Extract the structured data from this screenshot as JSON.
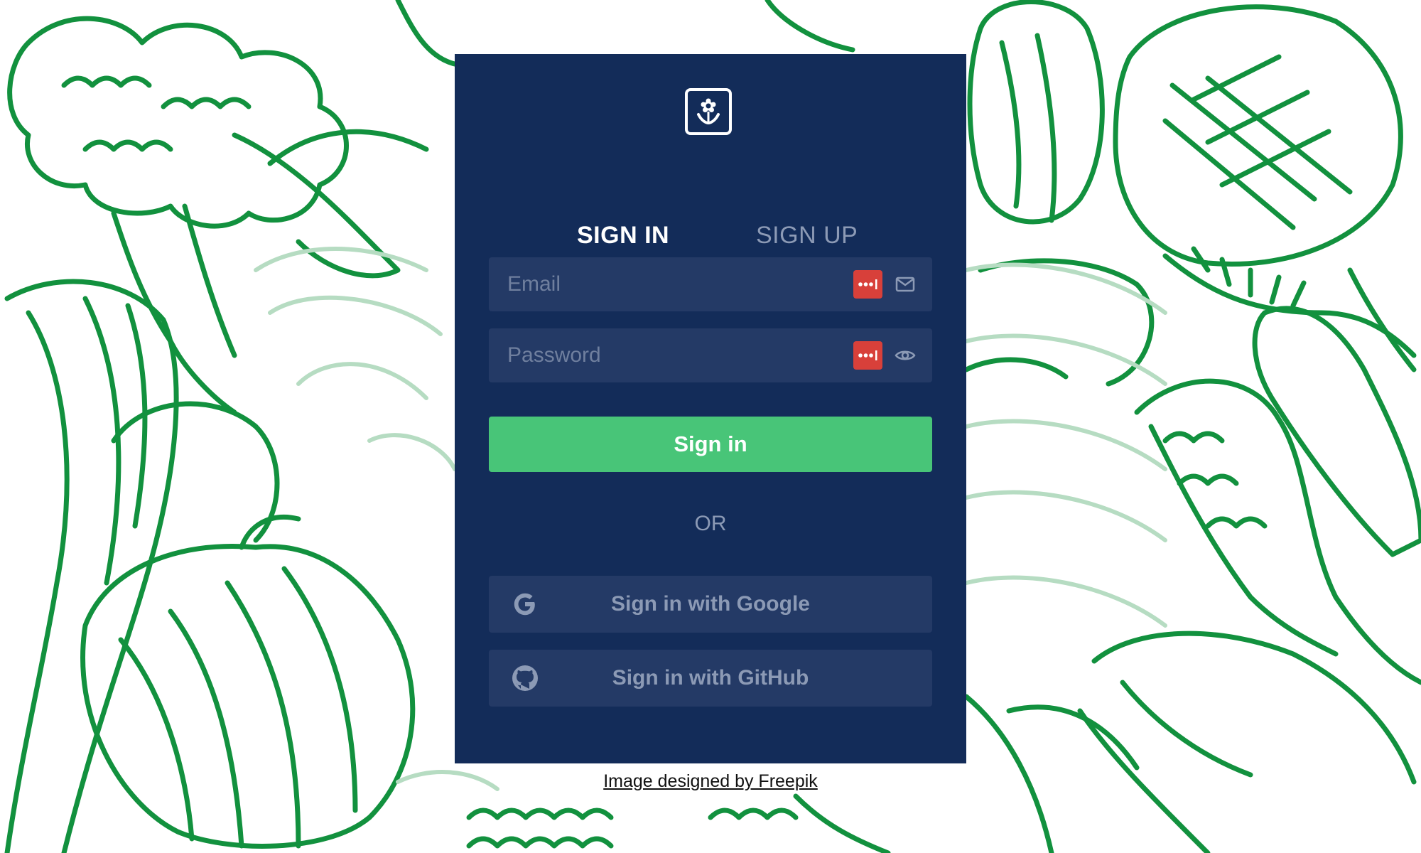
{
  "colors": {
    "card_background": "#132c59",
    "field_background": "#243a66",
    "primary_button": "#48c578",
    "password_manager_badge": "#d8403a",
    "muted_text": "#8c9ab5",
    "illustration_green": "#12913e"
  },
  "background": {
    "icon": "vegetable-illustration"
  },
  "logo": {
    "icon": "flower-icon"
  },
  "tabs": [
    {
      "label": "SIGN IN",
      "active": true
    },
    {
      "label": "SIGN UP",
      "active": false
    }
  ],
  "form": {
    "email": {
      "value": "",
      "placeholder": "Email",
      "icon": "mail-icon",
      "pm_icon": "password-manager-icon"
    },
    "password": {
      "value": "",
      "placeholder": "Password",
      "icon": "eye-icon",
      "pm_icon": "password-manager-icon"
    },
    "submit_label": "Sign in"
  },
  "divider_text": "OR",
  "social": [
    {
      "label": "Sign in with Google",
      "icon": "google-icon"
    },
    {
      "label": "Sign in with GitHub",
      "icon": "github-icon"
    }
  ],
  "credit": {
    "text": "Image designed by Freepik"
  }
}
